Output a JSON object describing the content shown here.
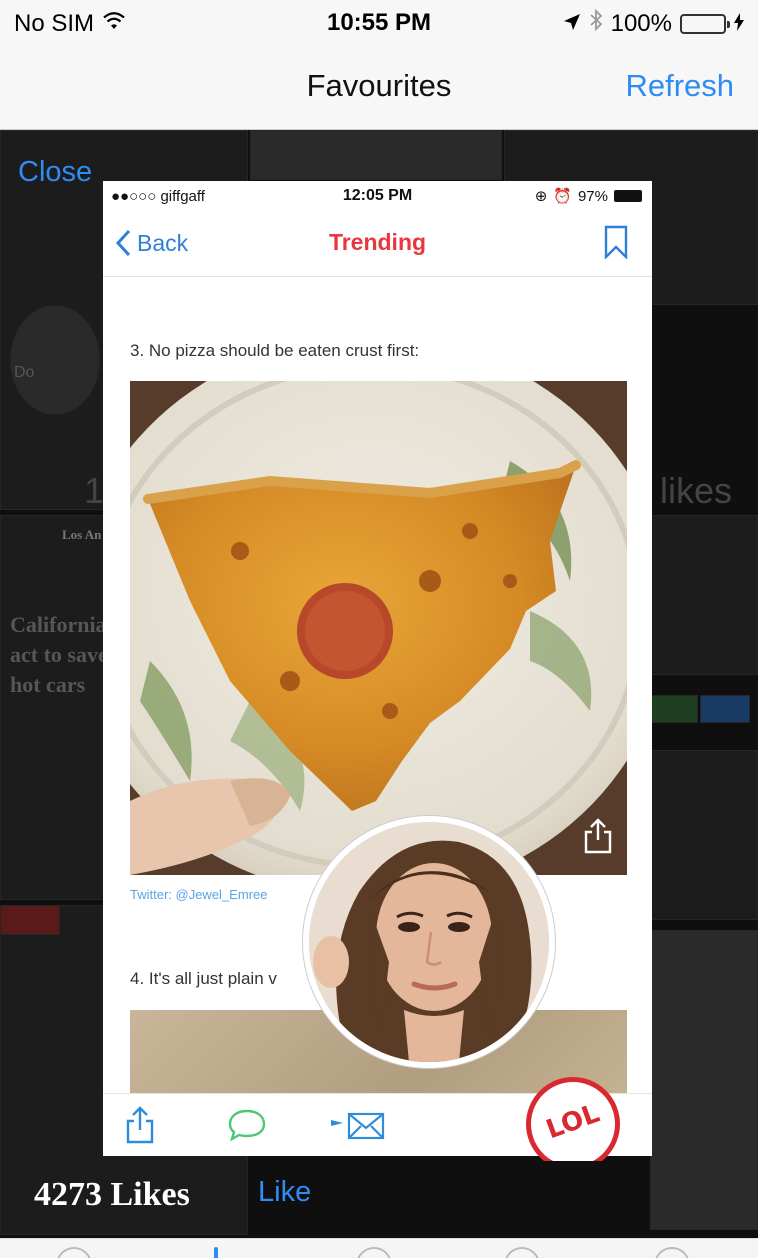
{
  "status_bar": {
    "carrier": "No SIM",
    "time": "10:55 PM",
    "battery": "100%"
  },
  "nav": {
    "title": "Favourites",
    "refresh_label": "Refresh"
  },
  "overlay": {
    "close_label": "Close",
    "likes_count": "4273 Likes",
    "like_label": "Like"
  },
  "background_fragments": {
    "headline": [
      "California",
      "act to save",
      "hot cars"
    ],
    "likes_a": "likes",
    "likes_b": "1",
    "small_text_1": "Do",
    "small_text_2": "Los An"
  },
  "card": {
    "status": {
      "carrier": "giffgaff",
      "time": "12:05 PM",
      "battery": "97%"
    },
    "nav": {
      "back_label": "Back",
      "title": "Trending"
    },
    "item3_heading": "3. No pizza should be eaten crust first:",
    "twitter_credit": "Twitter: @Jewel_Emree",
    "item4_heading": "4. It's all just plain v"
  },
  "lol_button": {
    "label": "LOL"
  },
  "colors": {
    "accent_blue": "#2f8cf2",
    "trending_red": "#e8383d",
    "lol_red": "#d9282f"
  },
  "icons": [
    "wifi-icon",
    "location-icon",
    "bluetooth-icon",
    "bookmark-icon",
    "share-icon",
    "comment-icon",
    "mail-icon"
  ]
}
